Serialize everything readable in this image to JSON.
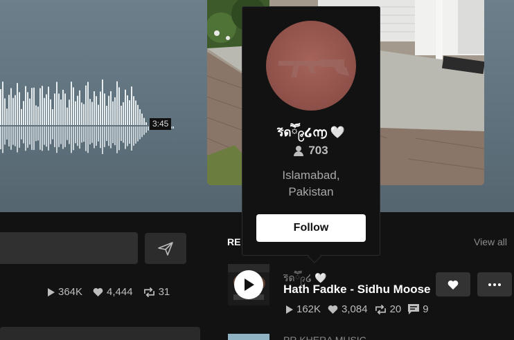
{
  "player": {
    "duration": "3:45"
  },
  "comment": {
    "placeholder": ""
  },
  "track_stats": {
    "plays": "364K",
    "likes": "4,444",
    "reposts": "31"
  },
  "popover": {
    "username": "ร̃ดཽ၉໒൬ 🤍",
    "followers": "703",
    "location_line1": "Islamabad,",
    "location_line2": "Pakistan",
    "follow_label": "Follow"
  },
  "related": {
    "heading": "RE",
    "view_all": "View all",
    "tracks": [
      {
        "artist": "ร̃ดཽ၉໒ 🤍",
        "title": "Hath Fadke - Sidhu Moose",
        "plays": "162K",
        "likes": "3,084",
        "reposts": "20",
        "comments": "9"
      },
      {
        "artist": "PR KHERA MUSIC"
      }
    ]
  }
}
